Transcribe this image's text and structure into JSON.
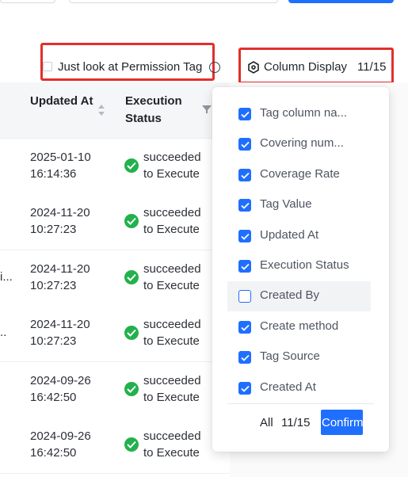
{
  "toolbar": {
    "permission_label": "Just look at Permission Tag",
    "column_display_label": "Column Display",
    "column_display_count": "11/15"
  },
  "table": {
    "headers": {
      "updated_at": "Updated At",
      "execution_status": "Execution Status"
    },
    "rows": [
      {
        "date": "2025-01-10",
        "time": "16:14:36",
        "status_line1": "succeeded",
        "status_line2": "to Execute",
        "trunc": ""
      },
      {
        "date": "2024-11-20",
        "time": "10:27:23",
        "status_line1": "succeeded",
        "status_line2": "to Execute",
        "trunc": ""
      },
      {
        "date": "2024-11-20",
        "time": "10:27:23",
        "status_line1": "succeeded",
        "status_line2": "to Execute",
        "trunc": "i..."
      },
      {
        "date": "2024-11-20",
        "time": "10:27:23",
        "status_line1": "succeeded",
        "status_line2": "to Execute",
        "trunc": ".."
      },
      {
        "date": "2024-09-26",
        "time": "16:42:50",
        "status_line1": "succeeded",
        "status_line2": "to Execute",
        "trunc": ""
      },
      {
        "date": "2024-09-26",
        "time": "16:42:50",
        "status_line1": "succeeded",
        "status_line2": "to Execute",
        "trunc": ""
      }
    ]
  },
  "column_popup": {
    "options": [
      {
        "label": "Tag column na...",
        "checked": true
      },
      {
        "label": "Covering num...",
        "checked": true
      },
      {
        "label": "Coverage Rate",
        "checked": true
      },
      {
        "label": "Tag Value",
        "checked": true
      },
      {
        "label": "Updated At",
        "checked": true
      },
      {
        "label": "Execution Status",
        "checked": true
      },
      {
        "label": "Created By",
        "checked": false
      },
      {
        "label": "Create method",
        "checked": true
      },
      {
        "label": "Tag Source",
        "checked": true
      },
      {
        "label": "Created At",
        "checked": true
      }
    ],
    "all_label": "All",
    "count": "11/15",
    "confirm_label": "Confirm"
  },
  "colors": {
    "primary": "#1f6fff",
    "success": "#22b14c",
    "highlight_box": "#e0302c"
  }
}
